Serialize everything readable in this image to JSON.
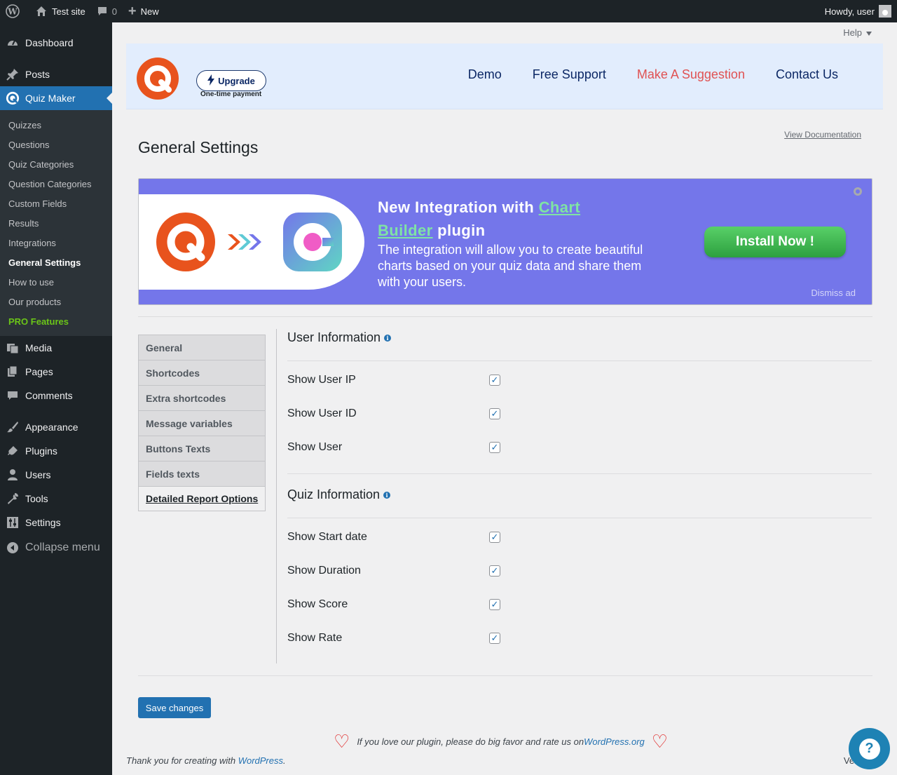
{
  "adminbar": {
    "site_name": "Test site",
    "comments_count": "0",
    "new_label": "New",
    "howdy": "Howdy, user"
  },
  "sidebar": {
    "dashboard": "Dashboard",
    "posts": "Posts",
    "quiz_maker": "Quiz Maker",
    "submenu": [
      "Quizzes",
      "Questions",
      "Quiz Categories",
      "Question Categories",
      "Custom Fields",
      "Results",
      "Integrations",
      "General Settings",
      "How to use",
      "Our products",
      "PRO Features"
    ],
    "media": "Media",
    "pages": "Pages",
    "comments": "Comments",
    "appearance": "Appearance",
    "plugins": "Plugins",
    "users": "Users",
    "tools": "Tools",
    "settings": "Settings",
    "collapse": "Collapse menu"
  },
  "help_tab": "Help",
  "header": {
    "upgrade": "Upgrade",
    "upgrade_note": "One-time payment",
    "nav": [
      "Demo",
      "Free Support",
      "Make A Suggestion",
      "Contact Us"
    ]
  },
  "page": {
    "title": "General Settings",
    "view_docs": "View Documentation"
  },
  "ad": {
    "title_prefix": "New Integration with ",
    "title_link": "Chart Builder",
    "title_suffix": " plugin",
    "description": "The integration will allow you to create beautiful charts based on your quiz data and share them with your users.",
    "install": "Install Now !",
    "dismiss": "Dismiss ad"
  },
  "tabs": [
    "General",
    "Shortcodes",
    "Extra shortcodes",
    "Message variables",
    "Buttons Texts",
    "Fields texts",
    "Detailed Report Options"
  ],
  "user_info": {
    "title": "User Information",
    "rows": [
      "Show User IP",
      "Show User ID",
      "Show User"
    ]
  },
  "quiz_info": {
    "title": "Quiz Information",
    "rows": [
      "Show Start date",
      "Show Duration",
      "Show Score",
      "Show Rate"
    ]
  },
  "save": "Save changes",
  "rate": {
    "text": "If you love our plugin, please do big favor and rate us on ",
    "link": "WordPress.org"
  },
  "footer": {
    "text": "Thank you for creating with ",
    "link": "WordPress",
    "version": "Versio"
  },
  "colors": {
    "accent": "#2271b1",
    "banner": "#7476ea",
    "install": "#3bb54a",
    "suggest": "#e05252"
  }
}
